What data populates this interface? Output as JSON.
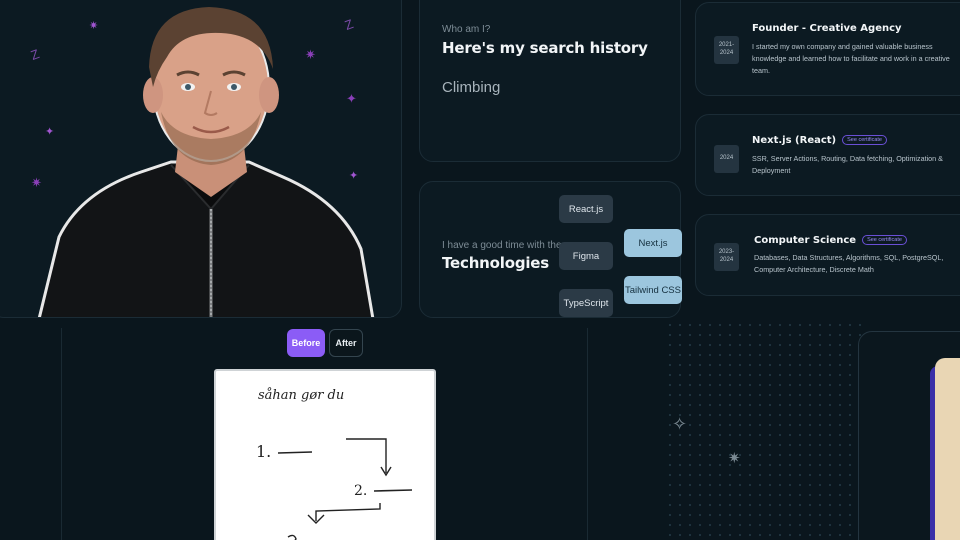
{
  "about": {
    "kicker": "Who am I?",
    "heading": "Here's my search history",
    "search_term": "Climbing"
  },
  "tech": {
    "kicker": "I have a good time with these",
    "heading": "Technologies",
    "chips": [
      "React.js",
      "Figma",
      "TypeScript",
      "Next.js",
      "Tailwind CSS"
    ]
  },
  "experience": [
    {
      "year_start": "2021-",
      "year_end": "2024",
      "title": "Founder - Creative Agency",
      "badge": "",
      "description": "I started my own company and gained valuable business knowledge and learned how to facilitate and work in a creative team."
    },
    {
      "year_start": "",
      "year_end": "2024",
      "title": "Next.js (React)",
      "badge": "See certificate",
      "description": "SSR, Server Actions, Routing, Data fetching, Optimization & Deployment"
    },
    {
      "year_start": "2023-",
      "year_end": "2024",
      "title": "Computer Science",
      "badge": "See certificate",
      "description": "Databases, Data Structures, Algorithms, SQL, PostgreSQL, Computer Architecture, Discrete Math"
    }
  ],
  "compare": {
    "before_label": "Before",
    "after_label": "After"
  },
  "sketch": {
    "line1": "såhan gør du",
    "step1": "1.",
    "step2": "2."
  },
  "colors": {
    "accent": "#8b5cf6",
    "chip_dark": "#2b3a46",
    "chip_light": "#9cc6de",
    "background": "#0a161d"
  }
}
